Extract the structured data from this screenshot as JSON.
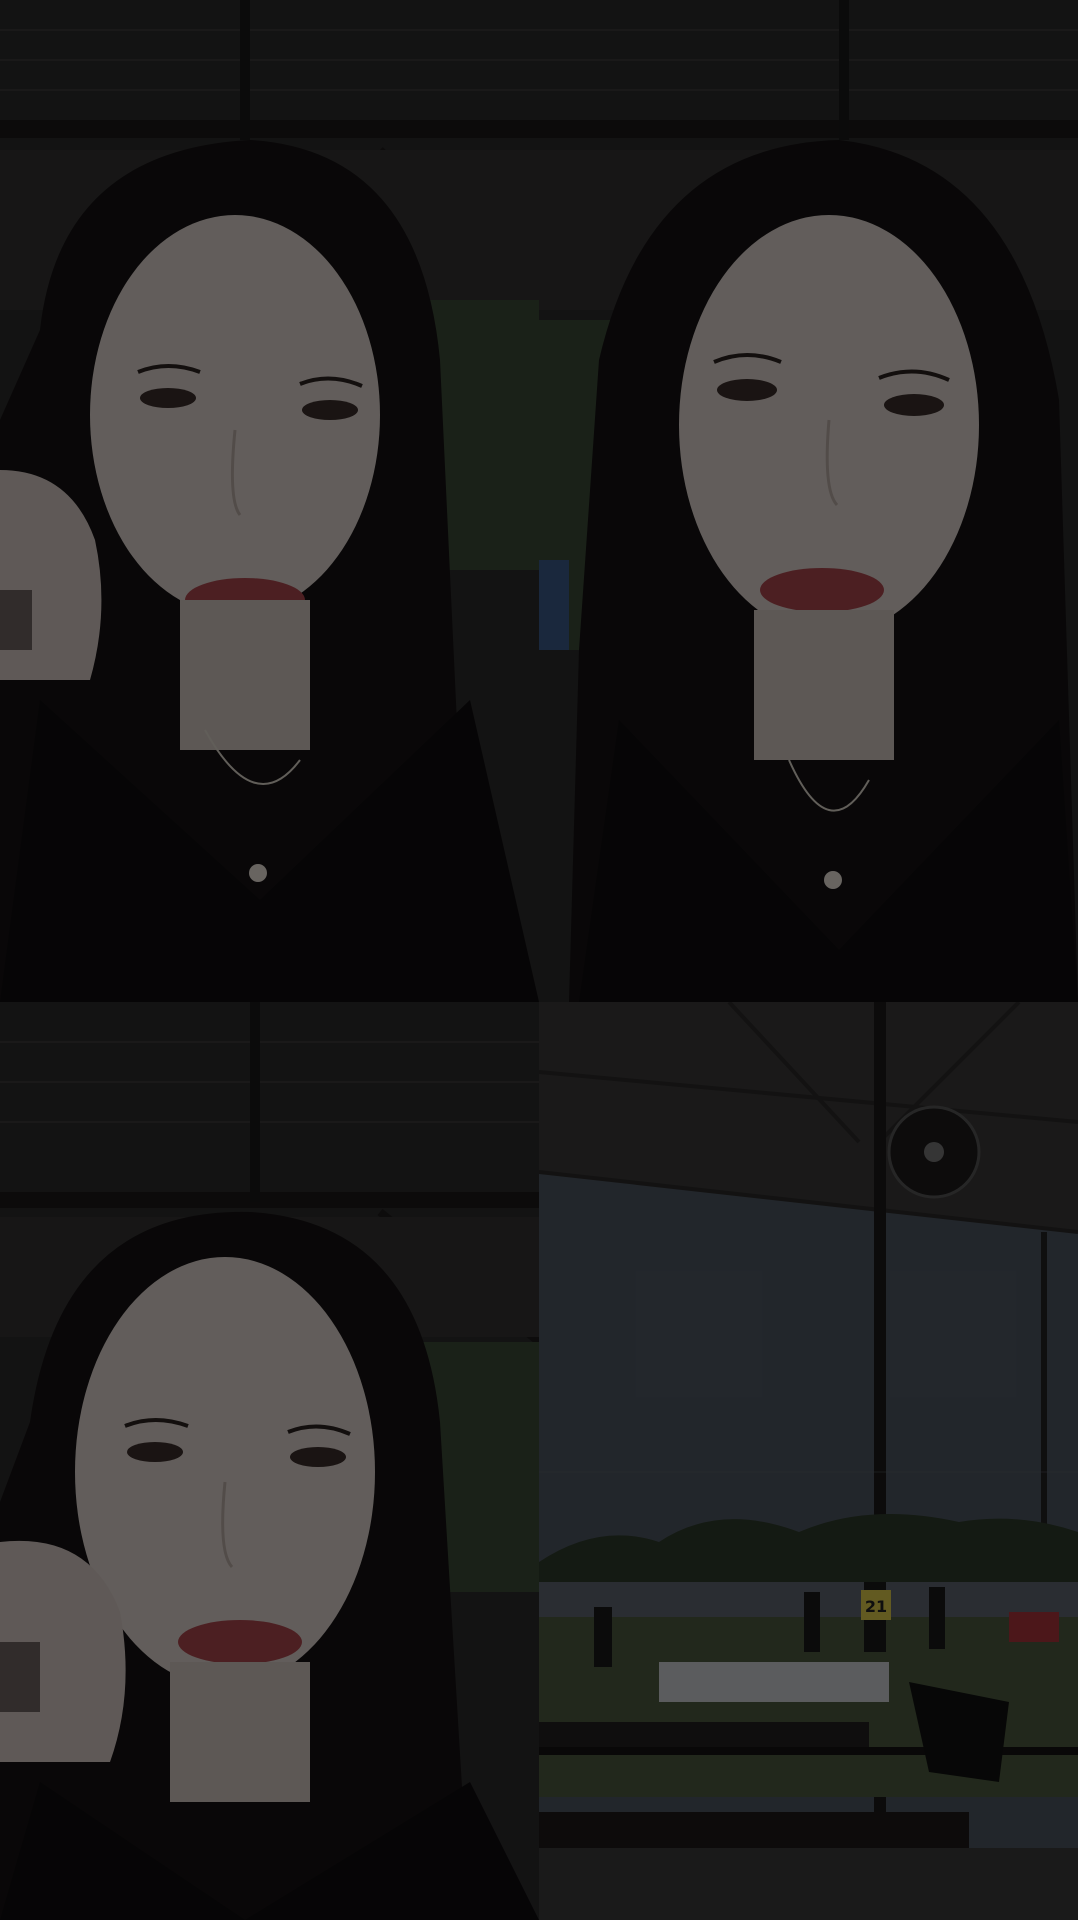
{
  "collage": {
    "layout": "2x2",
    "overlay": "dark-dim",
    "tiles": [
      {
        "subject": "selfie-hand-on-cheek"
      },
      {
        "subject": "selfie-front"
      },
      {
        "subject": "selfie-hand-on-cheek"
      },
      {
        "subject": "football-pitch-view"
      }
    ]
  },
  "scene": {
    "jersey_number": "21"
  },
  "colors": {
    "roof": "#2b2a2a",
    "skin": "#d9cfc9",
    "hair": "#141112",
    "lips": "#a9464d",
    "sky": "#4d5661",
    "grass": "#4c5a3e",
    "trees": "#2e3a2a"
  }
}
